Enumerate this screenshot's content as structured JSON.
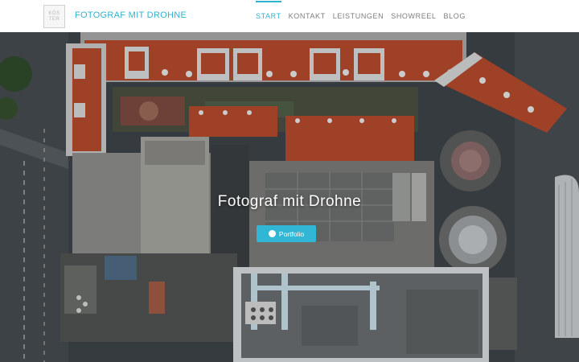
{
  "header": {
    "logo_lines": [
      "KÖS",
      "TER"
    ],
    "brand": "FOTOGRAF MIT DROHNE",
    "nav": [
      {
        "label": "START",
        "active": true
      },
      {
        "label": "KONTAKT",
        "active": false
      },
      {
        "label": "LEISTUNGEN",
        "active": false
      },
      {
        "label": "SHOWREEL",
        "active": false
      },
      {
        "label": "BLOG",
        "active": false
      }
    ]
  },
  "hero": {
    "title": "Fotograf mit Drohne",
    "button_label": "Portfolio",
    "button_icon": "check-circle-icon",
    "image_alt": "aerial-city-rooftops-image"
  },
  "colors": {
    "accent": "#2db3cf",
    "button": "#31b6d6",
    "nav_text": "#7d7d7d",
    "roof_red": "#b54a2c"
  }
}
